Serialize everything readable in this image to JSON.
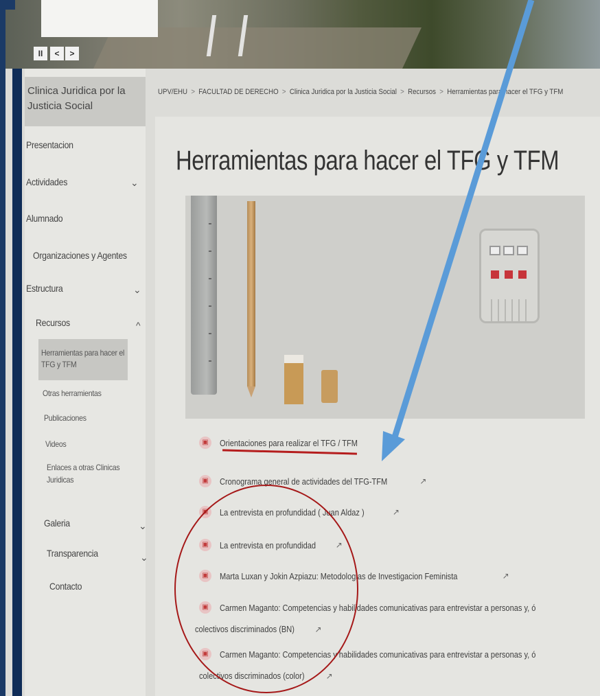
{
  "hero": {
    "controls": [
      {
        "icon": "pause-icon",
        "glyph": "II"
      },
      {
        "icon": "chevron-left-icon",
        "glyph": "<"
      },
      {
        "icon": "chevron-right-icon",
        "glyph": ">"
      }
    ]
  },
  "sidebar": {
    "title": "Clinica Juridica por la Justicia Social",
    "items": [
      {
        "label": "Presentacion",
        "expandable": false
      },
      {
        "label": "Actividades",
        "expandable": true
      },
      {
        "label": "Alumnado",
        "expandable": false
      },
      {
        "label": "Organizaciones y Agentes",
        "expandable": false
      },
      {
        "label": "Estructura",
        "expandable": true
      },
      {
        "label": "Recursos",
        "expandable": true,
        "expanded": true
      }
    ],
    "subitems": [
      {
        "label": "Herramientas para hacer el TFG y TFM",
        "active": true
      },
      {
        "label": "Otras herramientas"
      },
      {
        "label": "Publicaciones"
      },
      {
        "label": "Videos"
      },
      {
        "label": "Enlaces a otras Clinicas Juridicas"
      }
    ],
    "items_after": [
      {
        "label": "Galeria",
        "expandable": true
      },
      {
        "label": "Transparencia",
        "expandable": true
      },
      {
        "label": "Contacto",
        "expandable": false
      }
    ]
  },
  "breadcrumb": [
    "UPV/EHU",
    "FACULTAD DE DERECHO",
    "Clinica Juridica por la Justicia Social",
    "Recursos",
    "Herramientas para hacer el TFG y TFM"
  ],
  "page": {
    "title": "Herramientas para hacer el TFG y TFM"
  },
  "documents": [
    {
      "label": "Orientaciones para realizar el TFG / TFM"
    },
    {
      "label": "Cronograma general de actividades del TFG-TFM"
    },
    {
      "label": "La entrevista en profundidad ( Juan Aldaz )"
    },
    {
      "label": "La entrevista en profundidad"
    },
    {
      "label": "Marta Luxan y Jokin Azpiazu: Metodologias de Investigacion Feminista"
    },
    {
      "label": "Carmen Maganto: Competencias y habilidades comunicativas para entrevistar a personas y, ó",
      "continuation": "colectivos discriminados (BN)"
    },
    {
      "label": "Carmen Maganto: Competencias y habilidades comunicativas para entrevistar a personas y, ó",
      "continuation": "colectivos discriminados (color)"
    }
  ],
  "colors": {
    "annotation_red": "#b51d1d",
    "annotation_blue": "#5a9bd8",
    "pdf_red": "#c23b3b",
    "sidebar_active": "#c7c7c3"
  }
}
